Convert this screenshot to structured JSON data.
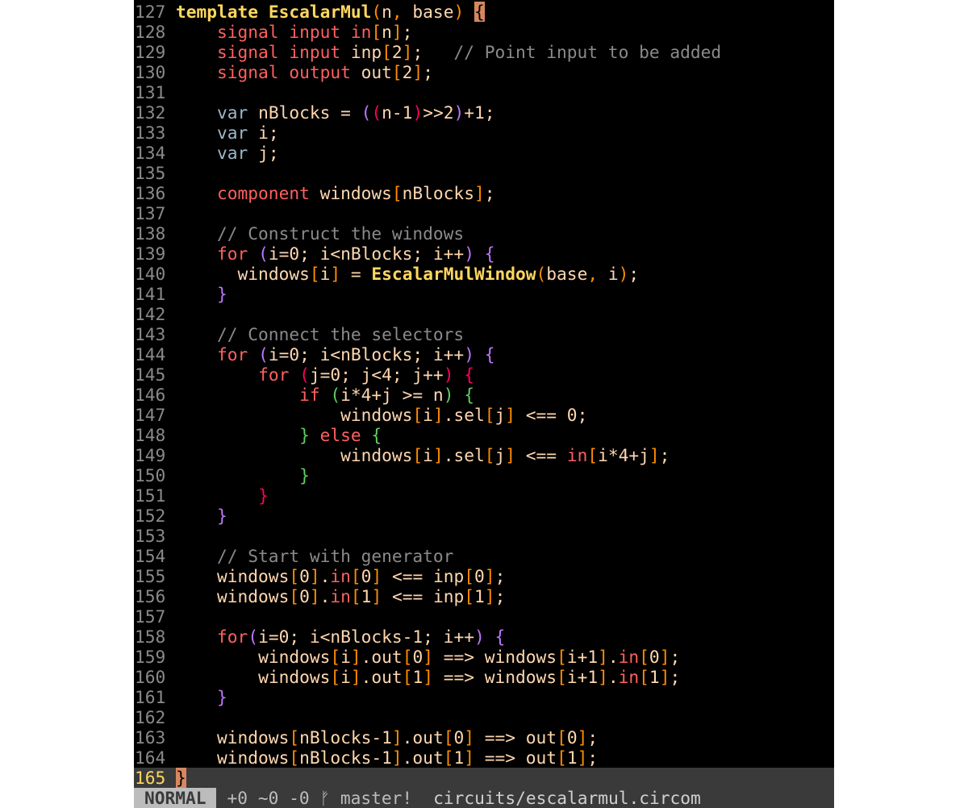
{
  "colors": {
    "background": "#000000",
    "line_number": "#8a8a8a",
    "current_line_number": "#ffd75f",
    "keyword_template": "#ffd75f",
    "signal_keyword": "#ff6060",
    "identifier": "#ffd7af",
    "comment": "#8a8a8a",
    "paren_level1": "#c076ff",
    "paren_level2": "#ff0060",
    "paren_level3": "#60d060",
    "bracket": "#ff8c00"
  },
  "editor": {
    "current_line": 165,
    "lines": [
      {
        "num": "127",
        "segments": [
          [
            "template ",
            "kw-template"
          ],
          [
            "EscalarMul",
            "func"
          ],
          [
            "(",
            "br"
          ],
          [
            "n",
            "id"
          ],
          [
            ", ",
            "br"
          ],
          [
            "base",
            "id"
          ],
          [
            ") ",
            "br"
          ],
          [
            "{",
            "cursorbr"
          ]
        ]
      },
      {
        "num": "128",
        "segments": [
          [
            "    ",
            "p"
          ],
          [
            "signal input ",
            "sig"
          ],
          [
            "in",
            "sig"
          ],
          [
            "[",
            "br"
          ],
          [
            "n",
            "id"
          ],
          [
            "]",
            "br"
          ],
          [
            ";",
            "p"
          ]
        ]
      },
      {
        "num": "129",
        "segments": [
          [
            "    ",
            "p"
          ],
          [
            "signal input ",
            "sig"
          ],
          [
            "inp",
            "id"
          ],
          [
            "[",
            "br"
          ],
          [
            "2",
            "id"
          ],
          [
            "]",
            "br"
          ],
          [
            ";   ",
            "p"
          ],
          [
            "// Point input to be added",
            "cm"
          ]
        ]
      },
      {
        "num": "130",
        "segments": [
          [
            "    ",
            "p"
          ],
          [
            "signal output ",
            "sig"
          ],
          [
            "out",
            "id"
          ],
          [
            "[",
            "br"
          ],
          [
            "2",
            "id"
          ],
          [
            "]",
            "br"
          ],
          [
            ";",
            "p"
          ]
        ]
      },
      {
        "num": "131",
        "segments": []
      },
      {
        "num": "132",
        "segments": [
          [
            "    ",
            "p"
          ],
          [
            "var ",
            "var"
          ],
          [
            "nBlocks = ",
            "id"
          ],
          [
            "(",
            "p1"
          ],
          [
            "(",
            "p2"
          ],
          [
            "n-1",
            "id"
          ],
          [
            ")",
            "p2"
          ],
          [
            ">>2",
            "id"
          ],
          [
            ")",
            "p1"
          ],
          [
            "+1;",
            "id"
          ]
        ]
      },
      {
        "num": "133",
        "segments": [
          [
            "    ",
            "p"
          ],
          [
            "var ",
            "var"
          ],
          [
            "i;",
            "id"
          ]
        ]
      },
      {
        "num": "134",
        "segments": [
          [
            "    ",
            "p"
          ],
          [
            "var ",
            "var"
          ],
          [
            "j;",
            "id"
          ]
        ]
      },
      {
        "num": "135",
        "segments": []
      },
      {
        "num": "136",
        "segments": [
          [
            "    ",
            "p"
          ],
          [
            "component ",
            "sig"
          ],
          [
            "windows",
            "id"
          ],
          [
            "[",
            "br"
          ],
          [
            "nBlocks",
            "id"
          ],
          [
            "]",
            "br"
          ],
          [
            ";",
            "p"
          ]
        ]
      },
      {
        "num": "137",
        "segments": []
      },
      {
        "num": "138",
        "segments": [
          [
            "    ",
            "p"
          ],
          [
            "// Construct the windows",
            "cm"
          ]
        ]
      },
      {
        "num": "139",
        "segments": [
          [
            "    ",
            "p"
          ],
          [
            "for ",
            "sig"
          ],
          [
            "(",
            "p1"
          ],
          [
            "i=0; i<nBlocks; i++",
            "id"
          ],
          [
            ")",
            "p1"
          ],
          [
            " ",
            "p"
          ],
          [
            "{",
            "p1"
          ]
        ]
      },
      {
        "num": "140",
        "segments": [
          [
            "      ",
            "p"
          ],
          [
            "windows",
            "id"
          ],
          [
            "[",
            "br"
          ],
          [
            "i",
            "id"
          ],
          [
            "]",
            "br"
          ],
          [
            " = ",
            "id"
          ],
          [
            "EscalarMulWindow",
            "func"
          ],
          [
            "(",
            "br"
          ],
          [
            "base",
            "id"
          ],
          [
            ", ",
            "br"
          ],
          [
            "i",
            "id"
          ],
          [
            ")",
            "br"
          ],
          [
            ";",
            "p"
          ]
        ]
      },
      {
        "num": "141",
        "segments": [
          [
            "    ",
            "p"
          ],
          [
            "}",
            "p1"
          ]
        ]
      },
      {
        "num": "142",
        "segments": []
      },
      {
        "num": "143",
        "segments": [
          [
            "    ",
            "p"
          ],
          [
            "// Connect the selectors",
            "cm"
          ]
        ]
      },
      {
        "num": "144",
        "segments": [
          [
            "    ",
            "p"
          ],
          [
            "for ",
            "sig"
          ],
          [
            "(",
            "p1"
          ],
          [
            "i=0; i<nBlocks; i++",
            "id"
          ],
          [
            ")",
            "p1"
          ],
          [
            " ",
            "p"
          ],
          [
            "{",
            "p1"
          ]
        ]
      },
      {
        "num": "145",
        "segments": [
          [
            "        ",
            "p"
          ],
          [
            "for ",
            "sig"
          ],
          [
            "(",
            "p2"
          ],
          [
            "j=0; j<4; j++",
            "id"
          ],
          [
            ")",
            "p2"
          ],
          [
            " ",
            "p"
          ],
          [
            "{",
            "p2"
          ]
        ]
      },
      {
        "num": "146",
        "segments": [
          [
            "            ",
            "p"
          ],
          [
            "if ",
            "sig"
          ],
          [
            "(",
            "p3"
          ],
          [
            "i*4+j >= n",
            "id"
          ],
          [
            ")",
            "p3"
          ],
          [
            " ",
            "p"
          ],
          [
            "{",
            "p3"
          ]
        ]
      },
      {
        "num": "147",
        "segments": [
          [
            "                ",
            "p"
          ],
          [
            "windows",
            "id"
          ],
          [
            "[",
            "br"
          ],
          [
            "i",
            "id"
          ],
          [
            "]",
            "br"
          ],
          [
            ".sel",
            "id"
          ],
          [
            "[",
            "br"
          ],
          [
            "j",
            "id"
          ],
          [
            "]",
            "br"
          ],
          [
            " <== 0;",
            "id"
          ]
        ]
      },
      {
        "num": "148",
        "segments": [
          [
            "            ",
            "p"
          ],
          [
            "}",
            "p3"
          ],
          [
            " else ",
            "sig"
          ],
          [
            "{",
            "p3"
          ]
        ]
      },
      {
        "num": "149",
        "segments": [
          [
            "                ",
            "p"
          ],
          [
            "windows",
            "id"
          ],
          [
            "[",
            "br"
          ],
          [
            "i",
            "id"
          ],
          [
            "]",
            "br"
          ],
          [
            ".sel",
            "id"
          ],
          [
            "[",
            "br"
          ],
          [
            "j",
            "id"
          ],
          [
            "]",
            "br"
          ],
          [
            " <== ",
            "id"
          ],
          [
            "in",
            "sig"
          ],
          [
            "[",
            "br"
          ],
          [
            "i*4+j",
            "id"
          ],
          [
            "]",
            "br"
          ],
          [
            ";",
            "p"
          ]
        ]
      },
      {
        "num": "150",
        "segments": [
          [
            "            ",
            "p"
          ],
          [
            "}",
            "p3"
          ]
        ]
      },
      {
        "num": "151",
        "segments": [
          [
            "        ",
            "p"
          ],
          [
            "}",
            "p2"
          ]
        ]
      },
      {
        "num": "152",
        "segments": [
          [
            "    ",
            "p"
          ],
          [
            "}",
            "p1"
          ]
        ]
      },
      {
        "num": "153",
        "segments": []
      },
      {
        "num": "154",
        "segments": [
          [
            "    ",
            "p"
          ],
          [
            "// Start with generator",
            "cm"
          ]
        ]
      },
      {
        "num": "155",
        "segments": [
          [
            "    ",
            "p"
          ],
          [
            "windows",
            "id"
          ],
          [
            "[",
            "br"
          ],
          [
            "0",
            "id"
          ],
          [
            "]",
            "br"
          ],
          [
            ".",
            "id"
          ],
          [
            "in",
            "sig"
          ],
          [
            "[",
            "br"
          ],
          [
            "0",
            "id"
          ],
          [
            "]",
            "br"
          ],
          [
            " <== inp",
            "id"
          ],
          [
            "[",
            "br"
          ],
          [
            "0",
            "id"
          ],
          [
            "]",
            "br"
          ],
          [
            ";",
            "p"
          ]
        ]
      },
      {
        "num": "156",
        "segments": [
          [
            "    ",
            "p"
          ],
          [
            "windows",
            "id"
          ],
          [
            "[",
            "br"
          ],
          [
            "0",
            "id"
          ],
          [
            "]",
            "br"
          ],
          [
            ".",
            "id"
          ],
          [
            "in",
            "sig"
          ],
          [
            "[",
            "br"
          ],
          [
            "1",
            "id"
          ],
          [
            "]",
            "br"
          ],
          [
            " <== inp",
            "id"
          ],
          [
            "[",
            "br"
          ],
          [
            "1",
            "id"
          ],
          [
            "]",
            "br"
          ],
          [
            ";",
            "p"
          ]
        ]
      },
      {
        "num": "157",
        "segments": []
      },
      {
        "num": "158",
        "segments": [
          [
            "    ",
            "p"
          ],
          [
            "for",
            "sig"
          ],
          [
            "(",
            "p1"
          ],
          [
            "i=0; i<nBlocks-1; i++",
            "id"
          ],
          [
            ")",
            "p1"
          ],
          [
            " ",
            "p"
          ],
          [
            "{",
            "p1"
          ]
        ]
      },
      {
        "num": "159",
        "segments": [
          [
            "        ",
            "p"
          ],
          [
            "windows",
            "id"
          ],
          [
            "[",
            "br"
          ],
          [
            "i",
            "id"
          ],
          [
            "]",
            "br"
          ],
          [
            ".out",
            "id"
          ],
          [
            "[",
            "br"
          ],
          [
            "0",
            "id"
          ],
          [
            "]",
            "br"
          ],
          [
            " ==> windows",
            "id"
          ],
          [
            "[",
            "br"
          ],
          [
            "i+1",
            "id"
          ],
          [
            "]",
            "br"
          ],
          [
            ".",
            "id"
          ],
          [
            "in",
            "sig"
          ],
          [
            "[",
            "br"
          ],
          [
            "0",
            "id"
          ],
          [
            "]",
            "br"
          ],
          [
            ";",
            "p"
          ]
        ]
      },
      {
        "num": "160",
        "segments": [
          [
            "        ",
            "p"
          ],
          [
            "windows",
            "id"
          ],
          [
            "[",
            "br"
          ],
          [
            "i",
            "id"
          ],
          [
            "]",
            "br"
          ],
          [
            ".out",
            "id"
          ],
          [
            "[",
            "br"
          ],
          [
            "1",
            "id"
          ],
          [
            "]",
            "br"
          ],
          [
            " ==> windows",
            "id"
          ],
          [
            "[",
            "br"
          ],
          [
            "i+1",
            "id"
          ],
          [
            "]",
            "br"
          ],
          [
            ".",
            "id"
          ],
          [
            "in",
            "sig"
          ],
          [
            "[",
            "br"
          ],
          [
            "1",
            "id"
          ],
          [
            "]",
            "br"
          ],
          [
            ";",
            "p"
          ]
        ]
      },
      {
        "num": "161",
        "segments": [
          [
            "    ",
            "p"
          ],
          [
            "}",
            "p1"
          ]
        ]
      },
      {
        "num": "162",
        "segments": []
      },
      {
        "num": "163",
        "segments": [
          [
            "    ",
            "p"
          ],
          [
            "windows",
            "id"
          ],
          [
            "[",
            "br"
          ],
          [
            "nBlocks-1",
            "id"
          ],
          [
            "]",
            "br"
          ],
          [
            ".out",
            "id"
          ],
          [
            "[",
            "br"
          ],
          [
            "0",
            "id"
          ],
          [
            "]",
            "br"
          ],
          [
            " ==> out",
            "id"
          ],
          [
            "[",
            "br"
          ],
          [
            "0",
            "id"
          ],
          [
            "]",
            "br"
          ],
          [
            ";",
            "p"
          ]
        ]
      },
      {
        "num": "164",
        "segments": [
          [
            "    ",
            "p"
          ],
          [
            "windows",
            "id"
          ],
          [
            "[",
            "br"
          ],
          [
            "nBlocks-1",
            "id"
          ],
          [
            "]",
            "br"
          ],
          [
            ".out",
            "id"
          ],
          [
            "[",
            "br"
          ],
          [
            "1",
            "id"
          ],
          [
            "]",
            "br"
          ],
          [
            " ==> out",
            "id"
          ],
          [
            "[",
            "br"
          ],
          [
            "1",
            "id"
          ],
          [
            "]",
            "br"
          ],
          [
            ";",
            "p"
          ]
        ]
      },
      {
        "num": "165",
        "segments": [
          [
            "}",
            "cursorbr"
          ]
        ]
      }
    ]
  },
  "statusline": {
    "mode": "NORMAL",
    "git": "+0 ~0 -0 ᚠ master!",
    "filename": "circuits/escalarmul.circom"
  }
}
